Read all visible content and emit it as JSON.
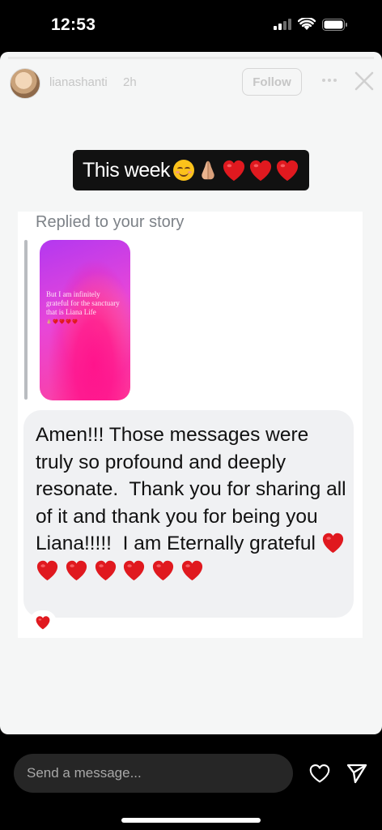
{
  "status_bar": {
    "time": "12:53"
  },
  "story": {
    "progress": 1.0,
    "username": "lianashanti",
    "time_ago": "2h",
    "follow_label": "Follow",
    "sticker_text": "This week",
    "sticker_emojis": [
      "smiling-face-icon",
      "folded-hands-icon",
      "red-heart-icon",
      "red-heart-icon",
      "red-heart-icon"
    ]
  },
  "reply": {
    "label": "Replied to your story",
    "thumbnail_text": "But I am infinitely grateful for the sanctuary that is Liana Life",
    "message_text": "Amen!!! Those messages were truly so profound and deeply resonate.  Thank you for sharing all of it and thank you for being you Liana!!!!!  I am Eternally grateful",
    "reaction": "red-heart-icon"
  },
  "composer": {
    "placeholder": "Send a message..."
  },
  "colors": {
    "heart": "#e0191f",
    "bubble": "#f0f1f3",
    "story_bg": "#f5f6f6",
    "input_bg": "#262626"
  }
}
